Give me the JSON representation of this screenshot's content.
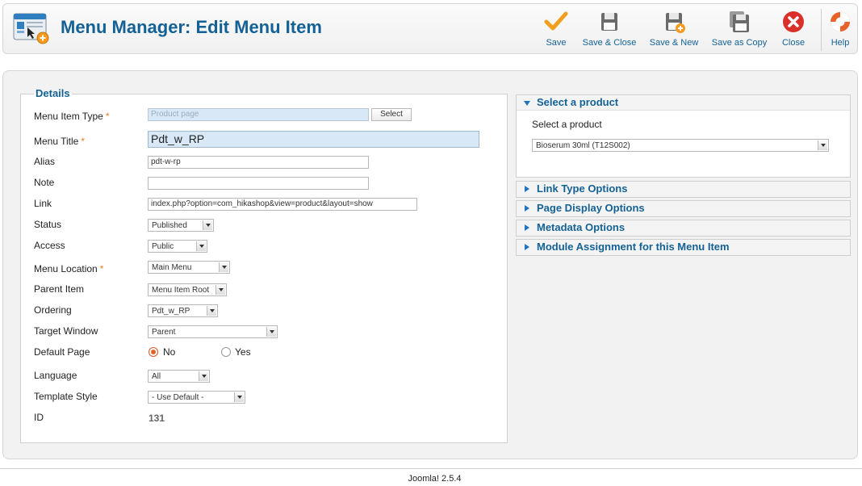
{
  "header": {
    "title": "Menu Manager: Edit Menu Item",
    "icon": "menu-manager-icon"
  },
  "toolbar": {
    "save": "Save",
    "save_close": "Save & Close",
    "save_new": "Save & New",
    "save_copy": "Save as Copy",
    "close": "Close",
    "help": "Help"
  },
  "details": {
    "legend": "Details",
    "required_mark": "*",
    "menu_item_type_label": "Menu Item Type",
    "menu_item_type_value": "Product page",
    "select_button": "Select",
    "menu_title_label": "Menu Title",
    "menu_title_value": "Pdt_w_RP",
    "alias_label": "Alias",
    "alias_value": "pdt-w-rp",
    "note_label": "Note",
    "note_value": "",
    "link_label": "Link",
    "link_value": "index.php?option=com_hikashop&view=product&layout=show",
    "status_label": "Status",
    "status_value": "Published",
    "access_label": "Access",
    "access_value": "Public",
    "menu_location_label": "Menu Location",
    "menu_location_value": "Main Menu",
    "parent_item_label": "Parent Item",
    "parent_item_value": "Menu Item Root",
    "ordering_label": "Ordering",
    "ordering_value": "Pdt_w_RP",
    "target_window_label": "Target Window",
    "target_window_value": "Parent",
    "default_page_label": "Default Page",
    "default_page_no": "No",
    "default_page_yes": "Yes",
    "default_page_selected": "No",
    "language_label": "Language",
    "language_value": "All",
    "template_style_label": "Template Style",
    "template_style_value": "- Use Default -",
    "id_label": "ID",
    "id_value": "131"
  },
  "panels": {
    "select_product": {
      "title": "Select a product",
      "label": "Select a product",
      "value": "Bioserum 30ml (T12S002)"
    },
    "link_type": "Link Type Options",
    "page_display": "Page Display Options",
    "metadata": "Metadata Options",
    "module_assignment": "Module Assignment for this Menu Item"
  },
  "footer": {
    "version": "Joomla! 2.5.4"
  },
  "colors": {
    "title_blue": "#146295",
    "accent_orange": "#e67e22",
    "close_red": "#d9302a"
  }
}
